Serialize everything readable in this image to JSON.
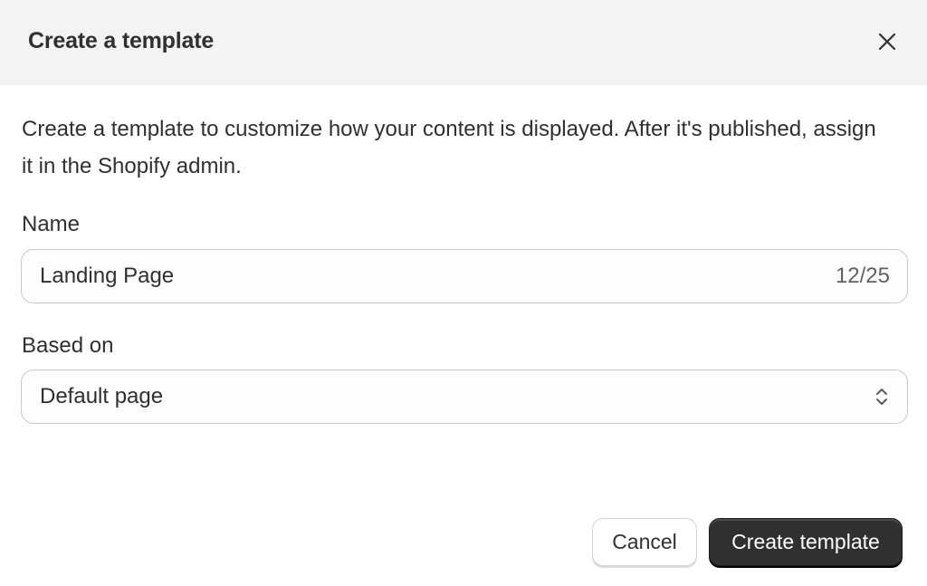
{
  "dialog": {
    "title": "Create a template",
    "close_icon": "close-icon"
  },
  "description": "Create a template to customize how your content is displayed. After it's published, assign it in the Shopify admin.",
  "name_field": {
    "label": "Name",
    "value": "Landing Page",
    "char_count": "12/25"
  },
  "based_on_field": {
    "label": "Based on",
    "selected": "Default page",
    "icon": "select-arrows-icon"
  },
  "actions": {
    "cancel_label": "Cancel",
    "create_label": "Create template"
  },
  "colors": {
    "header_bg": "#f3f3f3",
    "text": "#303030",
    "primary_button": "#303030",
    "border": "#c9c9c9"
  }
}
